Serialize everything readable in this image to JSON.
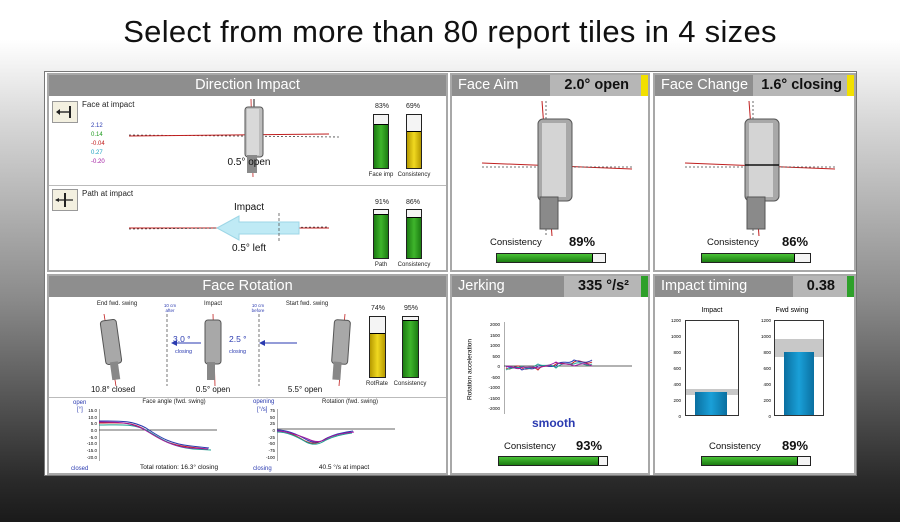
{
  "headline": "Select from more than 80 report tiles in 4 sizes",
  "colors": {
    "header_gray": "#8e8e8e",
    "value_gray": "#b6b6b6",
    "green": "#2ea02a",
    "yellow": "#f2e000",
    "blue_bar": "#1a8fc8"
  },
  "direction_impact": {
    "title": "Direction Impact",
    "face_label": "Face at impact",
    "face_values": [
      "2.12",
      "0.14",
      "-0.04",
      "0.27",
      "-0.20"
    ],
    "face_value_colors": [
      "#2a3ab0",
      "#1e9a1e",
      "#c01818",
      "#1aa0c0",
      "#a018a0"
    ],
    "face_result": "0.5° open",
    "face_bar1_pct": "83%",
    "face_bar1_value": 0.83,
    "face_bar1_label": "Face imp",
    "face_bar2_pct": "69%",
    "face_bar2_value": 0.69,
    "face_bar2_label": "Consistency",
    "path_label": "Path at impact",
    "path_impact_text": "Impact",
    "path_result": "0.5° left",
    "path_bar1_pct": "91%",
    "path_bar1_value": 0.91,
    "path_bar1_label": "Path",
    "path_bar2_pct": "86%",
    "path_bar2_value": 0.86,
    "path_bar2_label": "Consistency"
  },
  "face_aim": {
    "title": "Face Aim",
    "value": "2.0° open",
    "consistency_label": "Consistency",
    "consistency": "89%",
    "consistency_value": 0.89
  },
  "face_change": {
    "title": "Face Change",
    "value": "1.6° closing",
    "consistency_label": "Consistency",
    "consistency": "86%",
    "consistency_value": 0.86
  },
  "face_rotation": {
    "title": "Face Rotation",
    "end_label": "End fwd. swing",
    "impact_label": "Impact",
    "start_label": "Start fwd. swing",
    "after_note": "10 cm after",
    "before_note": "10 cm before",
    "rot1": "3.0 °",
    "rot1_note": "closing",
    "rot2": "2.5 °",
    "rot2_note": "closing",
    "end_result": "10.8° closed",
    "impact_result": "0.5° open",
    "start_result": "5.5° open",
    "bar1_pct": "74%",
    "bar1_value": 0.74,
    "bar1_label": "RotRate",
    "bar2_pct": "95%",
    "bar2_value": 0.95,
    "bar2_label": "Consistency",
    "chart1_title": "Face angle (fwd. swing)",
    "chart1_open": "open",
    "chart1_unit": "[°]",
    "chart1_closed": "closed",
    "chart1_ticks": [
      "15.0",
      "10.0",
      "5.0",
      "0.0",
      "-5.0",
      "-10.0",
      "-15.0",
      "-20.0"
    ],
    "chart1_caption": "Total rotation: 16.3° closing",
    "chart2_title": "Rotation (fwd. swing)",
    "chart2_open": "opening",
    "chart2_unit": "[°/s]",
    "chart2_closed": "closing",
    "chart2_ticks": [
      "75",
      "50",
      "25",
      "0",
      "-25",
      "-50",
      "-75",
      "-100"
    ],
    "chart2_caption": "40.5 °/s at impact"
  },
  "jerking": {
    "title": "Jerking",
    "value": "335 °/s²",
    "ylabel": "Rotation acceleration",
    "ticks": [
      "2000",
      "1500",
      "1000",
      "500",
      "0",
      "-500",
      "-1000",
      "-1500",
      "-2000"
    ],
    "verdict": "smooth",
    "consistency_label": "Consistency",
    "consistency": "93%",
    "consistency_value": 0.93
  },
  "impact_timing": {
    "title": "Impact timing",
    "value": "0.38",
    "col1_label": "Impact",
    "col2_label": "Fwd swing",
    "ticks": [
      "1200",
      "1000",
      "800",
      "600",
      "400",
      "200",
      "0"
    ],
    "col1_value": 290,
    "col2_value": 790,
    "consistency_label": "Consistency",
    "consistency": "89%",
    "consistency_value": 0.89
  }
}
